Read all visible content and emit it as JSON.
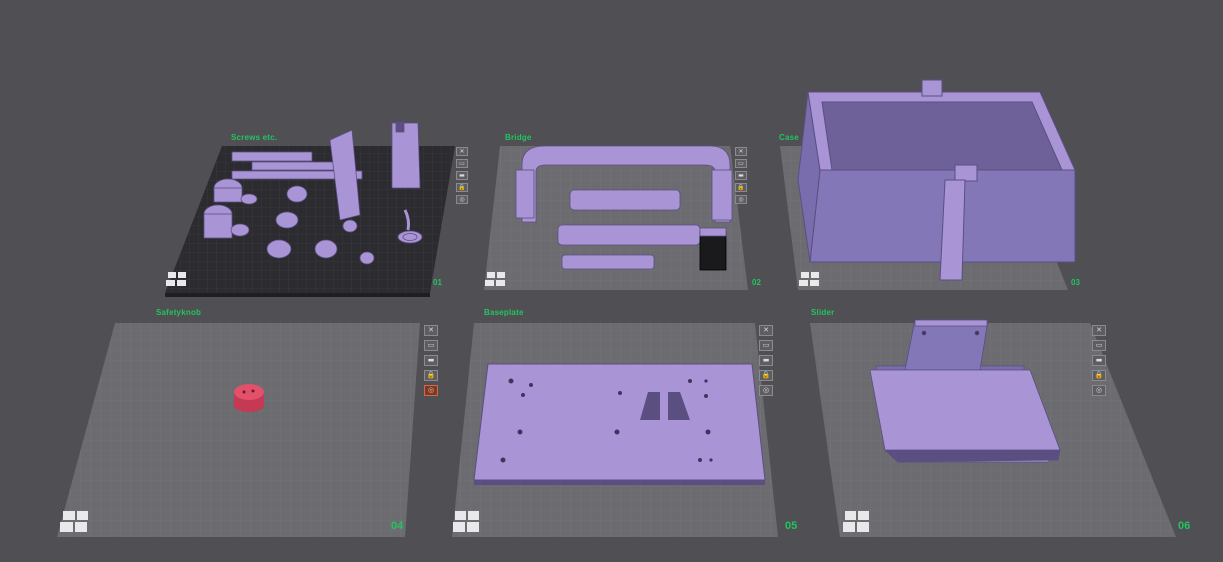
{
  "plates": [
    {
      "name": "Screws etc.",
      "number": "01"
    },
    {
      "name": "Bridge",
      "number": "02"
    },
    {
      "name": "Case",
      "number": "03"
    },
    {
      "name": "Safetyknob",
      "number": "04"
    },
    {
      "name": "Baseplate",
      "number": "05"
    },
    {
      "name": "Slider",
      "number": "06"
    }
  ],
  "plate_tools": [
    {
      "icon": "close-icon",
      "glyph": "✕"
    },
    {
      "icon": "arrange-icon",
      "glyph": "▭"
    },
    {
      "icon": "orient-icon",
      "glyph": "▬"
    },
    {
      "icon": "lock-icon",
      "glyph": "🔒"
    },
    {
      "icon": "settings-icon",
      "glyph": "◎"
    }
  ],
  "colors": {
    "background": "#4f4f54",
    "plate": "#6b6b70",
    "model": "#a995d6",
    "model_shadow": "#5b4f82",
    "knob": "#e2506a",
    "label_green": "#22c55e"
  }
}
